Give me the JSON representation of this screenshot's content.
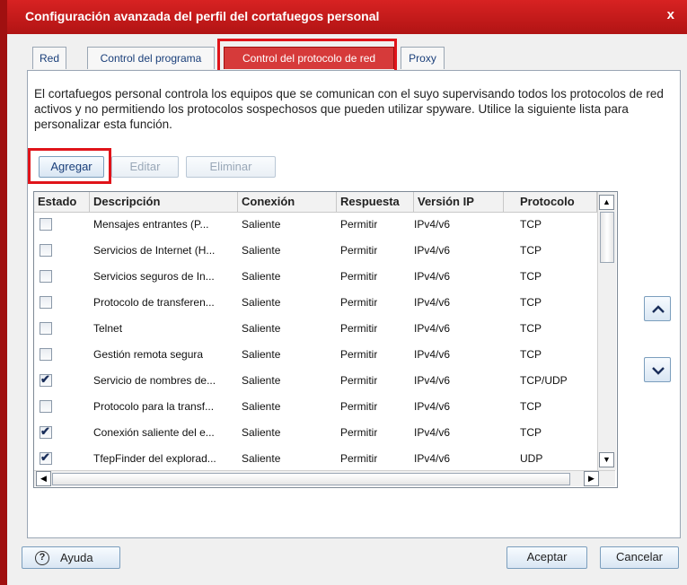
{
  "window": {
    "title": "Configuración avanzada del perfil del cortafuegos personal",
    "close_glyph": "x"
  },
  "tabs": [
    {
      "label": "Red"
    },
    {
      "label": "Control del programa"
    },
    {
      "label": "Control del protocolo de red",
      "active": true
    },
    {
      "label": "Proxy"
    }
  ],
  "description": "El cortafuegos personal controla los equipos que se comunican con el suyo supervisando todos los protocolos de red activos y no permitiendo los protocolos sospechosos que pueden utilizar spyware. Utilice la siguiente lista para personalizar esta función.",
  "actions": {
    "add": "Agregar",
    "edit": "Editar",
    "delete": "Eliminar"
  },
  "table": {
    "columns": [
      "Estado",
      "Descripción",
      "Conexión",
      "Respuesta",
      "Versión IP",
      "Protocolo"
    ],
    "rows": [
      {
        "checked": false,
        "description": "Mensajes entrantes (P...",
        "connection": "Saliente",
        "response": "Permitir",
        "ip_version": "IPv4/v6",
        "protocol": "TCP"
      },
      {
        "checked": false,
        "description": "Servicios de Internet (H...",
        "connection": "Saliente",
        "response": "Permitir",
        "ip_version": "IPv4/v6",
        "protocol": "TCP"
      },
      {
        "checked": false,
        "description": "Servicios seguros de In...",
        "connection": "Saliente",
        "response": "Permitir",
        "ip_version": "IPv4/v6",
        "protocol": "TCP"
      },
      {
        "checked": false,
        "description": "Protocolo de transferen...",
        "connection": "Saliente",
        "response": "Permitir",
        "ip_version": "IPv4/v6",
        "protocol": "TCP"
      },
      {
        "checked": false,
        "description": "Telnet",
        "connection": "Saliente",
        "response": "Permitir",
        "ip_version": "IPv4/v6",
        "protocol": "TCP"
      },
      {
        "checked": false,
        "description": "Gestión remota segura",
        "connection": "Saliente",
        "response": "Permitir",
        "ip_version": "IPv4/v6",
        "protocol": "TCP"
      },
      {
        "checked": true,
        "description": "Servicio de nombres de...",
        "connection": "Saliente",
        "response": "Permitir",
        "ip_version": "IPv4/v6",
        "protocol": "TCP/UDP"
      },
      {
        "checked": false,
        "description": "Protocolo para la transf...",
        "connection": "Saliente",
        "response": "Permitir",
        "ip_version": "IPv4/v6",
        "protocol": "TCP"
      },
      {
        "checked": true,
        "description": "Conexión saliente del e...",
        "connection": "Saliente",
        "response": "Permitir",
        "ip_version": "IPv4/v6",
        "protocol": "TCP"
      },
      {
        "checked": true,
        "description": "TfepFinder del explorad...",
        "connection": "Saliente",
        "response": "Permitir",
        "ip_version": "IPv4/v6",
        "protocol": "UDP"
      }
    ]
  },
  "footer": {
    "help": "Ayuda",
    "help_icon": "?",
    "ok": "Aceptar",
    "cancel": "Cancelar"
  },
  "colors": {
    "title_bar": "#c81a1a",
    "active_tab": "#d63a3a",
    "highlight_border": "#e0141a",
    "link_text": "#1a3f7a"
  },
  "icons": [
    "close-icon",
    "help-icon",
    "move-up-icon",
    "move-down-icon",
    "checkbox-icon"
  ]
}
